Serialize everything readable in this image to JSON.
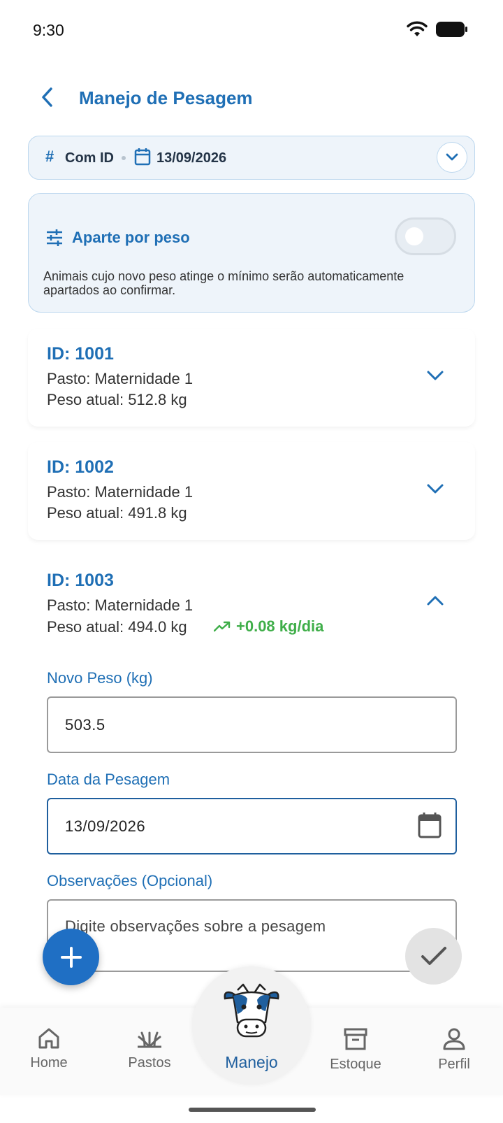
{
  "status": {
    "time": "9:30"
  },
  "header": {
    "title": "Manejo de Pesagem"
  },
  "filter": {
    "mode": "Com ID",
    "date": "13/09/2026"
  },
  "aparte": {
    "title": "Aparte por peso",
    "enabled": false,
    "description": "Animais cujo novo peso atinge o mínimo serão automaticamente apartados ao confirmar."
  },
  "animals": [
    {
      "id": "ID: 1001",
      "pasto": "Pasto: Maternidade 1",
      "peso": "Peso atual: 512.8 kg",
      "expanded": false
    },
    {
      "id": "ID: 1002",
      "pasto": "Pasto: Maternidade 1",
      "peso": "Peso atual: 491.8 kg",
      "expanded": false
    },
    {
      "id": "ID: 1003",
      "pasto": "Pasto: Maternidade 1",
      "peso": "Peso atual: 494.0 kg",
      "gain": "+0.08 kg/dia",
      "expanded": true
    }
  ],
  "form": {
    "novo_peso_label": "Novo Peso (kg)",
    "novo_peso_value": "503.5",
    "data_label": "Data da Pesagem",
    "data_value": "13/09/2026",
    "obs_label": "Observações (Opcional)",
    "obs_placeholder": "Digite observações sobre a pesagem"
  },
  "nav": {
    "home": "Home",
    "pastos": "Pastos",
    "manejo": "Manejo",
    "estoque": "Estoque",
    "perfil": "Perfil"
  },
  "colors": {
    "primary": "#1f6fb5",
    "gain": "#3fae49",
    "fab": "#1f6fc4"
  }
}
